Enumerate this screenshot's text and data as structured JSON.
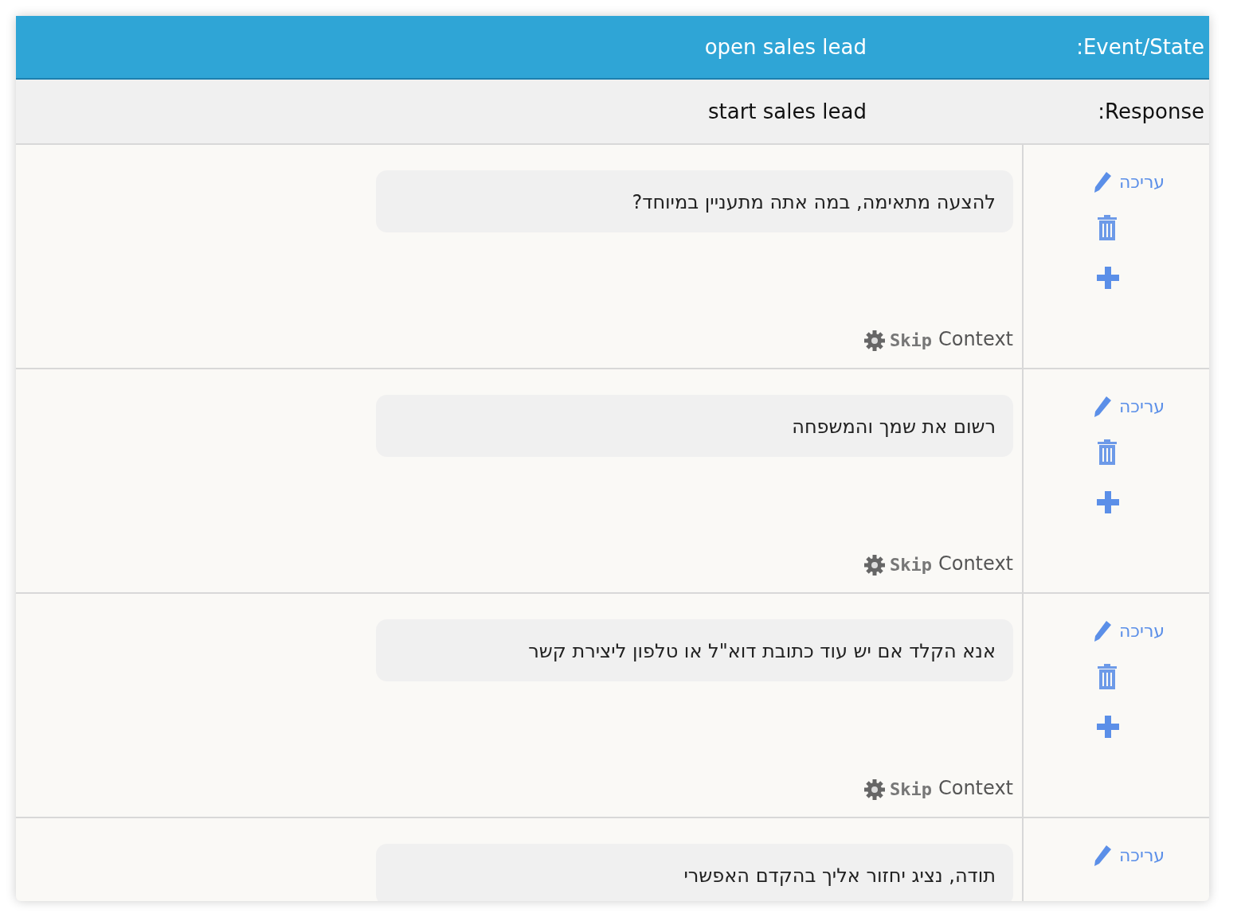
{
  "header": {
    "label": ":Event/State",
    "value": "open sales lead"
  },
  "response": {
    "label": ":Response",
    "value": "start sales lead"
  },
  "rows": [
    {
      "message": "להצעה מתאימה, במה אתה מתעניין במיוחד?",
      "skip": "Skip",
      "context": "Context",
      "edit": "עריכה",
      "actions": [
        {
          "kind": "delete"
        },
        {
          "kind": "add"
        }
      ]
    },
    {
      "message": "רשום את שמך והמשפחה",
      "skip": "Skip",
      "context": "Context",
      "edit": "עריכה",
      "actions": [
        {
          "kind": "delete"
        },
        {
          "kind": "add"
        }
      ]
    },
    {
      "message": "אנא הקלד אם יש עוד כתובת דוא\"ל או טלפון ליצירת קשר",
      "skip": "Skip",
      "context": "Context",
      "edit": "עריכה",
      "actions": [
        {
          "kind": "delete"
        },
        {
          "kind": "add"
        }
      ]
    },
    {
      "message": "תודה, נציג יחזור אליך בהקדם האפשרי",
      "edit": "עריכה"
    }
  ]
}
